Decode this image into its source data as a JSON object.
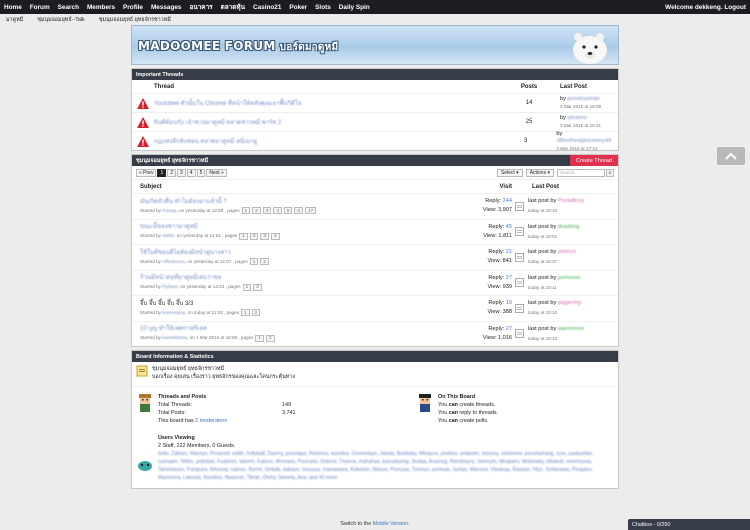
{
  "nav": {
    "items": [
      "Home",
      "Forum",
      "Search",
      "Members",
      "Profile",
      "Messages",
      "อนาคาร",
      "ตลาดหุ้น",
      "Casino21",
      "Poker",
      "Slots",
      "Daily Spin"
    ],
    "welcome": "Welcome dekkeng. Logout"
  },
  "breadcrumb": [
    "มาดูหมี",
    "ชุมนุมจอมยุทธ์--Talk",
    "ชุมนุมจอมยุทธ์ ยุทธจักรชาวหมี"
  ],
  "banner": {
    "logo": "MADOOMEE FORUM",
    "logo_thai": "บอร์ดมาดูหมี"
  },
  "important": {
    "header": "Important Threads",
    "col_thread": "Thread",
    "col_posts": "Posts",
    "col_last": "Last Post",
    "rows": [
      {
        "title": "Youtubee ตัวนั้นใน Chrome ที่หน้าให้หลังคุณเอาพื้นวิดีโอ",
        "posts": "14",
        "by": "by",
        "user": "pooniryaman",
        "date": "3 Mar 2016 at 16:09"
      },
      {
        "title": "ยินดีต้อนรับ เจ้าชายมาดูหมี ตลาดชาวหมี พาร์ท 2",
        "posts": "25",
        "by": "by",
        "user": "pleaons",
        "date": "3 Mar 2016 at 16:41"
      },
      {
        "title": "กฎแห่งลึกลับซ่อน ตลาดมาดูหมี หนีเมาอู",
        "posts": "3",
        "by": "by",
        "user": "Jilberthedgiotommy44",
        "date": "3 Mar 2016 at 17:21"
      }
    ]
  },
  "forum": {
    "header": "ชุมนุมจอมยุทธ์ ยุทธจักรชาวหมี",
    "create_label": "Create Thread",
    "prev_label": "« Prev",
    "pages": [
      "1",
      "2",
      "3",
      "4",
      "5"
    ],
    "next_label": "Next »",
    "select_label": "Select",
    "actions_label": "Actions",
    "search_placeholder": "Search...",
    "col_subject": "Subject",
    "col_visit": "Visit",
    "col_last": "Last Post",
    "threads": [
      {
        "title": "มันเกิดหัวตื่น ทำไมต้องมาแล้วนี้ ?",
        "blur": true,
        "started": "Started by",
        "starter": "Poiuap",
        "when": ", on yesterday at 12:59 , pages",
        "pages": [
          "1",
          "2",
          "3",
          "4",
          "5",
          "6",
          "17"
        ],
        "reply_label": "Reply:",
        "reply": "244",
        "view_label": "View:",
        "view": "3,907",
        "last_by": "last post by",
        "last_user": "Pooadkryy",
        "last_time": "today at 19:16"
      },
      {
        "title": "ขณะนี้ของชาวมาดูหมี",
        "blur": true,
        "started": "Started by",
        "starter": "wtifnb",
        "when": ", on yesterday at 14:51 , pages",
        "pages": [
          "1",
          "2",
          "3",
          "4"
        ],
        "reply_label": "Reply:",
        "reply": "45",
        "view_label": "View:",
        "view": "1,811",
        "last_by": "last post by",
        "last_user": "drashing",
        "last_time": "today at 19:01"
      },
      {
        "title": "ใช้ในที่ชอบดีไม่ต้องมีหน้าดูนางสาว",
        "blur": true,
        "started": "Started by",
        "starter": "Affanbrooo",
        "when": ", on yesterday at 12:07 , pages",
        "pages": [
          "1",
          "2"
        ],
        "reply_label": "Reply:",
        "reply": "21",
        "view_label": "View:",
        "view": "841",
        "last_by": "last post by",
        "last_user": "pmmys",
        "last_time": "today at 18:37"
      },
      {
        "title": "ก็วนมีหน้าต่อที่มาดูหมี่เล่นว่าขอ",
        "blur": true,
        "started": "Started by",
        "starter": "Pjofaps",
        "when": ", on yesterday at 14:23 , pages",
        "pages": [
          "1",
          "2"
        ],
        "reply_label": "Reply:",
        "reply": "27",
        "view_label": "View:",
        "view": "939",
        "last_by": "last post by",
        "last_user": "pomesso",
        "last_time": "today at 19:11"
      },
      {
        "title": "จึ้บ จึ้บ จึ้บ จึ้บ จึ้บ 3/3",
        "blur": false,
        "started": "Started by",
        "starter": "kuamtrqing",
        "when": ", on today at 11:53 , pages",
        "pages": [
          "1",
          "2"
        ],
        "reply_label": "Reply:",
        "reply": "19",
        "view_label": "View:",
        "view": "388",
        "last_by": "last post by",
        "last_user": "piggering",
        "last_time": "today at 19:10"
      },
      {
        "title": "10 บุญ ทำให้เทศกาลกิเลส",
        "blur": true,
        "started": "Started by",
        "starter": "kamahbizha",
        "when": ", on 1 Mar 2016 at 16:08 , pages",
        "pages": [
          "1",
          "2"
        ],
        "reply_label": "Reply:",
        "reply": "27",
        "view_label": "View:",
        "view": "1,016",
        "last_by": "last post by",
        "last_user": "warrimoon",
        "last_time": "today at 19:13"
      }
    ]
  },
  "board": {
    "header": "Board Information & Statistics",
    "name": "ชุมนุมจอมยุทธ์ ยุทธจักรชาวหมี",
    "desc": "บอกเรื่อง คุยเล่น เรื่องราว ยุทธจักรของคุณและโคนกระตุ้นทาง",
    "threads_posts": "Threads and Posts",
    "total_threads_label": "Total Threads:",
    "total_threads": "149",
    "total_posts_label": "Total Posts:",
    "total_posts": "3,741",
    "moderators_pre": "This board has",
    "moderators_link": "2 moderators",
    "on_board": "On This Board",
    "perm_pre": "You",
    "perm_can": "can",
    "perms": [
      "create threads.",
      "reply to threads.",
      "create polls."
    ],
    "users_viewing": "Users Viewing",
    "users_count": "2 Staff, 122 Members, 0 Guests.",
    "users_list": "bollo, Zabaro, Haneyo, Ponanoll, oxlith, hollyball, Daomy, pooniqaa, Ranmoo, wutsiloa, Dunmelayo, Jakala, Bunbaby, Minayoo, peekoo, ankpolm, moossy, seelanew, pooshwirang, ryoo, paakumbe, oumaam, Tellen, polishiar, Fuakiroo, lakorm, Eatnoo, Ahmawa, Puunaris, Ooboni, Thanna, mahahaa, kamahpong, Jirataa, Anamyg, Ramibayra, Veeroyto, Moaparo, Woloneby, kittakob, meemyosa, Tammanam, Pumpura, Kihuzop, nainoo, Borrel, Siribab, dakaoo, moozaa, Inamawara, Kokomin, Wasso, Preeyaa, Tomoyo, peelouk, Juniaa, Manoon, Viwanaa, Raopan, Hiyo, Sottanawa, Pinaploo, Mamonna, Lakoota, Bamboo, Naamoo, Tiktak, Ohmy, Sweeta, Ana, and 49 more"
  },
  "footer": {
    "pre": "Switch to the",
    "link": "Mobile Version",
    "post": "."
  },
  "chatbox": {
    "label": "Chatbox - 0/250"
  }
}
